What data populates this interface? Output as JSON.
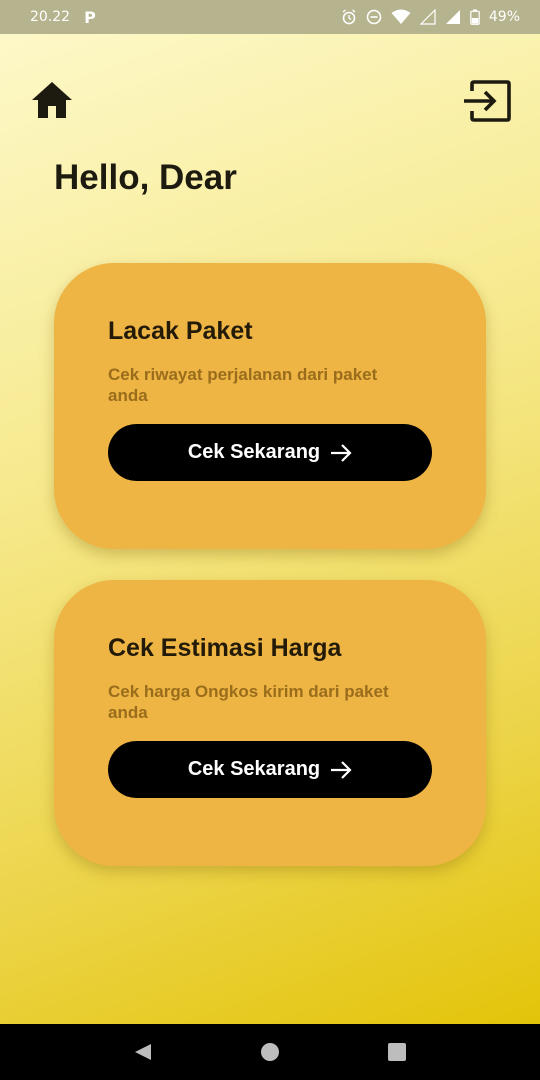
{
  "status_bar": {
    "time": "20.22",
    "battery": "49%"
  },
  "header": {
    "greeting": "Hello, Dear",
    "home_icon": "home-icon",
    "logout_icon": "logout-icon"
  },
  "cards": [
    {
      "title": "Lacak Paket",
      "description": "Cek riwayat perjalanan dari paket anda",
      "button_label": "Cek Sekarang"
    },
    {
      "title": "Cek Estimasi Harga",
      "description": "Cek harga Ongkos kirim dari paket anda",
      "button_label": "Cek Sekarang"
    }
  ],
  "colors": {
    "card_bg": "#eeb544",
    "button_bg": "#000000",
    "title_text": "#231a08",
    "desc_text": "#9a6d1c",
    "bg_gradient_top": "#fdf8c8",
    "bg_gradient_bottom": "#e3c40a"
  }
}
